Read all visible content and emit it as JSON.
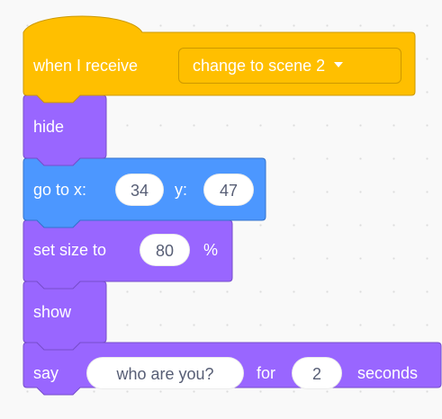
{
  "colors": {
    "events": "#ffbf00",
    "events_border": "#cc9900",
    "looks": "#9966ff",
    "looks_border": "#774dcb",
    "motion": "#4c97ff",
    "motion_border": "#3373cc",
    "input_text": "#575e75",
    "label_text": "#ffffff"
  },
  "script": {
    "hat": {
      "label": "when I receive",
      "message": "change to scene 2",
      "dropdown_icon": "caret-down-icon"
    },
    "hide": {
      "label": "hide"
    },
    "go_to": {
      "label_x": "go to x:",
      "x_value": "34",
      "label_y": "y:",
      "y_value": "47"
    },
    "set_size": {
      "label": "set size to",
      "value": "80",
      "unit": "%"
    },
    "show": {
      "label": "show"
    },
    "say_for": {
      "label": "say",
      "message": "who are you?",
      "label_for": "for",
      "secs_value": "2",
      "label_seconds": "seconds"
    }
  }
}
